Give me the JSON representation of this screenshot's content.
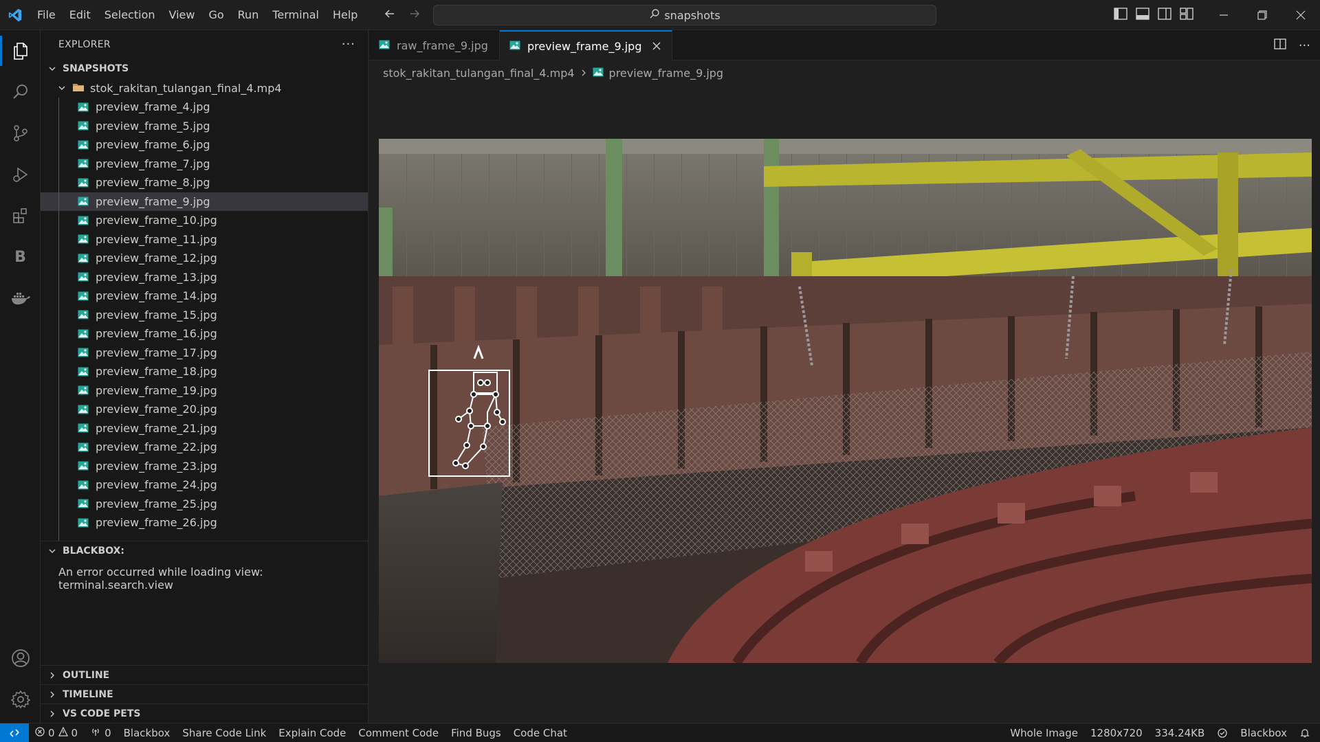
{
  "menu": [
    "File",
    "Edit",
    "Selection",
    "View",
    "Go",
    "Run",
    "Terminal",
    "Help"
  ],
  "search": {
    "text": "snapshots"
  },
  "sidebar": {
    "title": "EXPLORER",
    "root_label": "SNAPSHOTS",
    "folder_label": "stok_rakitan_tulangan_final_4.mp4",
    "files": [
      "preview_frame_4.jpg",
      "preview_frame_5.jpg",
      "preview_frame_6.jpg",
      "preview_frame_7.jpg",
      "preview_frame_8.jpg",
      "preview_frame_9.jpg",
      "preview_frame_10.jpg",
      "preview_frame_11.jpg",
      "preview_frame_12.jpg",
      "preview_frame_13.jpg",
      "preview_frame_14.jpg",
      "preview_frame_15.jpg",
      "preview_frame_16.jpg",
      "preview_frame_17.jpg",
      "preview_frame_18.jpg",
      "preview_frame_19.jpg",
      "preview_frame_20.jpg",
      "preview_frame_21.jpg",
      "preview_frame_22.jpg",
      "preview_frame_23.jpg",
      "preview_frame_24.jpg",
      "preview_frame_25.jpg",
      "preview_frame_26.jpg"
    ],
    "selected_file": "preview_frame_9.jpg",
    "blackbox_label": "BLACKBOX:",
    "blackbox_message": "An error occurred while loading view: terminal.search.view",
    "outline_label": "OUTLINE",
    "timeline_label": "TIMELINE",
    "pets_label": "VS CODE PETS"
  },
  "tabs": [
    {
      "label": "raw_frame_9.jpg",
      "active": false
    },
    {
      "label": "preview_frame_9.jpg",
      "active": true
    }
  ],
  "breadcrumb": {
    "folder": "stok_rakitan_tulangan_final_4.mp4",
    "file": "preview_frame_9.jpg"
  },
  "statusbar": {
    "errors": "0",
    "warnings": "0",
    "ports": "0",
    "items": [
      "Blackbox",
      "Share Code Link",
      "Explain Code",
      "Comment Code",
      "Find Bugs",
      "Code Chat"
    ],
    "zoom": "Whole Image",
    "dimensions": "1280x720",
    "size": "334.24KB",
    "right_label": "Blackbox"
  },
  "colors": {
    "accent": "#0078d4",
    "background": "#1f1f1f",
    "sidebar": "#181818",
    "image_icon": "#26a69a"
  }
}
